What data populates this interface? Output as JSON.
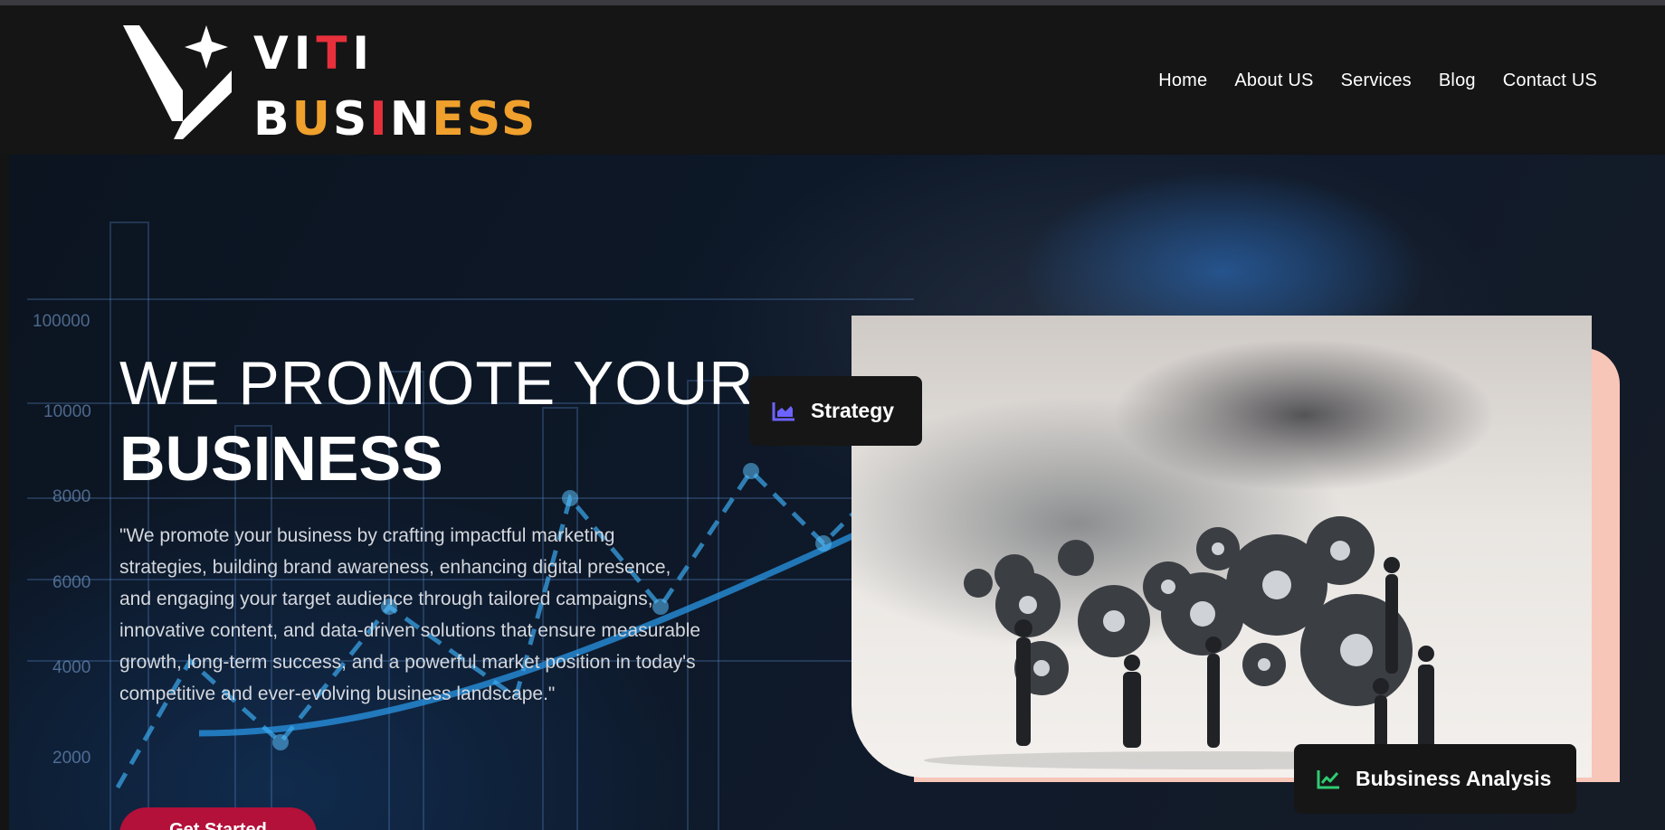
{
  "brand": {
    "line1": [
      {
        "t": "V",
        "c": "w"
      },
      {
        "t": "I",
        "c": "w"
      },
      {
        "t": "T",
        "c": "r"
      },
      {
        "t": "I",
        "c": "w"
      }
    ],
    "line2": [
      {
        "t": "B",
        "c": "w"
      },
      {
        "t": "U",
        "c": "o"
      },
      {
        "t": "S",
        "c": "w"
      },
      {
        "t": "I",
        "c": "r"
      },
      {
        "t": "N",
        "c": "w"
      },
      {
        "t": "E",
        "c": "o"
      },
      {
        "t": "S",
        "c": "o"
      },
      {
        "t": "S",
        "c": "o"
      }
    ],
    "colors": {
      "white": "#ffffff",
      "red": "#e8303c",
      "orange": "#f0a02c"
    }
  },
  "nav": {
    "items": [
      {
        "label": "Home"
      },
      {
        "label": "About US"
      },
      {
        "label": "Services"
      },
      {
        "label": "Blog"
      },
      {
        "label": "Contact US"
      }
    ]
  },
  "hero": {
    "title_line1": "WE PROMOTE YOUR",
    "title_line2": "BUSINESS",
    "description": "\"We promote your business by crafting impactful marketing strategies, building brand awareness, enhancing digital presence, and engaging your target audience through tailored campaigns, innovative content, and data-driven solutions that ensure measurable growth, long-term success, and a powerful market position in today's competitive and ever-evolving business landscape.\"",
    "cta_label": "Get Started",
    "background_axis_labels": [
      "100000",
      "10000",
      "8000",
      "6000",
      "4000",
      "2000"
    ],
    "cta_color": "#b3103a"
  },
  "badges": {
    "strategy": {
      "label": "Strategy",
      "icon": "area-chart-icon",
      "icon_color": "#6c63ff"
    },
    "analysis": {
      "label": "Bubsiness Analysis",
      "icon": "line-chart-icon",
      "icon_color": "#2ecc71"
    }
  },
  "card": {
    "accent": "#f8c6b8",
    "image": "businesspeople-with-gears-image"
  }
}
